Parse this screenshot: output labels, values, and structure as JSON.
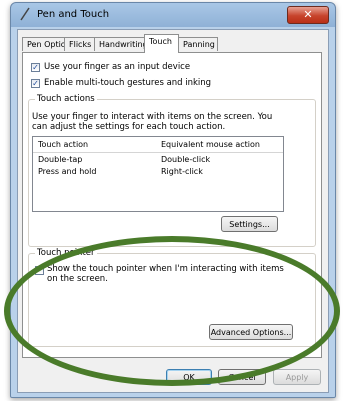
{
  "window": {
    "title": "Pen and Touch",
    "close_glyph": "✕"
  },
  "tabs": [
    {
      "label": "Pen Options"
    },
    {
      "label": "Flicks"
    },
    {
      "label": "Handwriting"
    },
    {
      "label": "Touch"
    },
    {
      "label": "Panning"
    }
  ],
  "active_tab": "Touch",
  "options": {
    "use_finger": {
      "label": "Use your finger as an input device",
      "checked": true
    },
    "multi_touch": {
      "label": "Enable multi-touch gestures and inking",
      "checked": true
    }
  },
  "touch_actions": {
    "title": "Touch actions",
    "description_line1": "Use your finger to interact with items on the screen. You",
    "description_line2": "can adjust the settings for each touch action.",
    "columns": [
      "Touch action",
      "Equivalent mouse action"
    ],
    "rows": [
      {
        "action": "Double-tap",
        "mouse": "Double-click"
      },
      {
        "action": "Press and hold",
        "mouse": "Right-click"
      }
    ],
    "settings_button": "Settings..."
  },
  "touch_pointer": {
    "title": "Touch pointer",
    "show_label_line1": "Show the touch pointer when I'm interacting with items",
    "show_label_line2": "on the screen.",
    "checked": false,
    "advanced_button": "Advanced Options..."
  },
  "footer": {
    "ok": "OK",
    "cancel": "Cancel",
    "apply": "Apply"
  },
  "colors": {
    "highlight_ellipse": "#4a7b2a",
    "title_bar": "#a9c7e6",
    "close_button": "#c7442c"
  }
}
